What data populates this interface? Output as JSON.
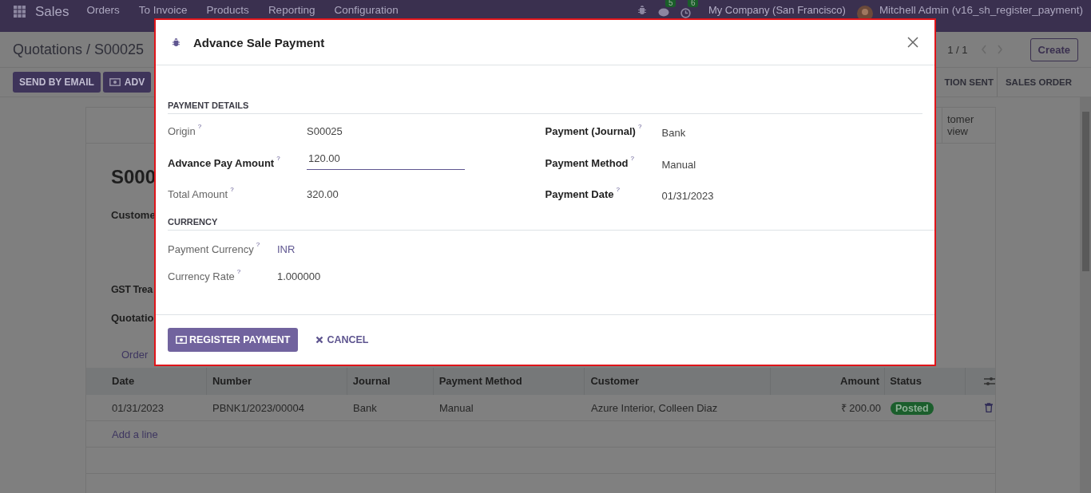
{
  "navbar": {
    "app": "Sales",
    "menu": [
      "Orders",
      "To Invoice",
      "Products",
      "Reporting",
      "Configuration"
    ],
    "chat_count": "5",
    "activity_count": "6",
    "company": "My Company (San Francisco)",
    "user": "Mitchell Admin (v16_sh_register_payment)"
  },
  "breadcrumb": "Quotations / S00025",
  "pager": "1 / 1",
  "create": "Create",
  "actions": [
    "SEND BY EMAIL",
    "ADV"
  ],
  "statusbar": [
    "TION SENT",
    "SALES ORDER"
  ],
  "form": {
    "smart_button": "tomer view",
    "name": "S000",
    "labels": [
      "Custome",
      "GST Trea",
      "Quotatio"
    ],
    "tab": "Order"
  },
  "payments": {
    "columns": [
      "Date",
      "Number",
      "Journal",
      "Payment Method",
      "Customer",
      "Amount",
      "Status"
    ],
    "rows": [
      {
        "date": "01/31/2023",
        "number": "PBNK1/2023/00004",
        "journal": "Bank",
        "method": "Manual",
        "customer": "Azure Interior, Colleen Diaz",
        "amount": "₹ 200.00",
        "status": "Posted"
      }
    ],
    "add_line": "Add a line"
  },
  "dialog": {
    "title": "Advance Sale Payment",
    "sections": [
      {
        "heading": "PAYMENT DETAILS",
        "columns": [
          [
            {
              "label": "Origin",
              "help": "?",
              "value": "S00025",
              "kind": "text",
              "required": false
            },
            {
              "label": "Advance Pay Amount",
              "help": "?",
              "value": "120.00",
              "kind": "input",
              "required": true
            },
            {
              "label": "Total Amount",
              "help": "?",
              "value": "320.00",
              "kind": "text",
              "required": false
            }
          ],
          [
            {
              "label": "Payment (Journal)",
              "help": "?",
              "value": "Bank",
              "kind": "text",
              "required": true
            },
            {
              "label": "Payment Method",
              "help": "?",
              "value": "Manual",
              "kind": "text",
              "required": true
            },
            {
              "label": "Payment Date",
              "help": "?",
              "value": "01/31/2023",
              "kind": "text",
              "required": true
            }
          ]
        ]
      },
      {
        "heading": "CURRENCY",
        "columns": [
          [
            {
              "label": "Payment Currency",
              "help": "?",
              "value": "INR",
              "kind": "link",
              "required": false
            },
            {
              "label": "Currency Rate",
              "help": "?",
              "value": "1.000000",
              "kind": "text",
              "required": false
            }
          ]
        ]
      }
    ],
    "primary": "REGISTER PAYMENT",
    "cancel": "CANCEL"
  }
}
